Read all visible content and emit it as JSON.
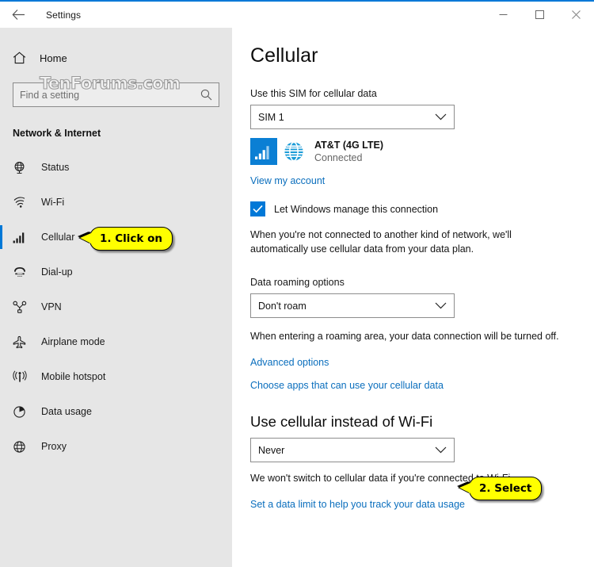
{
  "window": {
    "title": "Settings",
    "back_icon": "back-arrow-icon",
    "minimize_label": "–",
    "maximize_label": "□",
    "close_label": "✕"
  },
  "sidebar": {
    "home_label": "Home",
    "search_placeholder": "Find a setting",
    "watermark": "TenForums.com",
    "category": "Network & Internet",
    "items": [
      {
        "label": "Status",
        "icon": "globe-status-icon",
        "selected": false
      },
      {
        "label": "Wi-Fi",
        "icon": "wifi-icon",
        "selected": false
      },
      {
        "label": "Cellular",
        "icon": "cellular-bars-icon",
        "selected": true
      },
      {
        "label": "Dial-up",
        "icon": "telephone-icon",
        "selected": false
      },
      {
        "label": "VPN",
        "icon": "vpn-icon",
        "selected": false
      },
      {
        "label": "Airplane mode",
        "icon": "airplane-icon",
        "selected": false
      },
      {
        "label": "Mobile hotspot",
        "icon": "hotspot-icon",
        "selected": false
      },
      {
        "label": "Data usage",
        "icon": "pie-chart-icon",
        "selected": false
      },
      {
        "label": "Proxy",
        "icon": "globe-icon",
        "selected": false
      }
    ]
  },
  "main": {
    "page_title": "Cellular",
    "sim_label": "Use this SIM for cellular data",
    "sim_value": "SIM 1",
    "carrier_name": "AT&T (4G LTE)",
    "carrier_status": "Connected",
    "view_account_link": "View my account",
    "manage_checkbox_label": "Let Windows manage this connection",
    "manage_description": "When you're not connected to another kind of network, we'll automatically use cellular data from your data plan.",
    "roaming_label": "Data roaming options",
    "roaming_value": "Don't roam",
    "roaming_description": "When entering a roaming area, your data connection will be turned off.",
    "advanced_options_link": "Advanced options",
    "choose_apps_link": "Choose apps that can use your cellular data",
    "cellular_instead_heading": "Use cellular instead of Wi-Fi",
    "cellular_instead_value": "Never",
    "cellular_instead_description": "We won't switch to cellular data if you're connected to Wi-Fi.",
    "data_limit_link": "Set a data limit to help you track your data usage"
  },
  "callouts": [
    {
      "text": "1. Click on"
    },
    {
      "text": "2. Select"
    }
  ],
  "colors": {
    "accent": "#0078d7",
    "sidebar_bg": "#e6e6e6",
    "link": "#0a6ebd",
    "callout_bg": "#ffff00",
    "carrier_tile": "#0b7fd4"
  }
}
